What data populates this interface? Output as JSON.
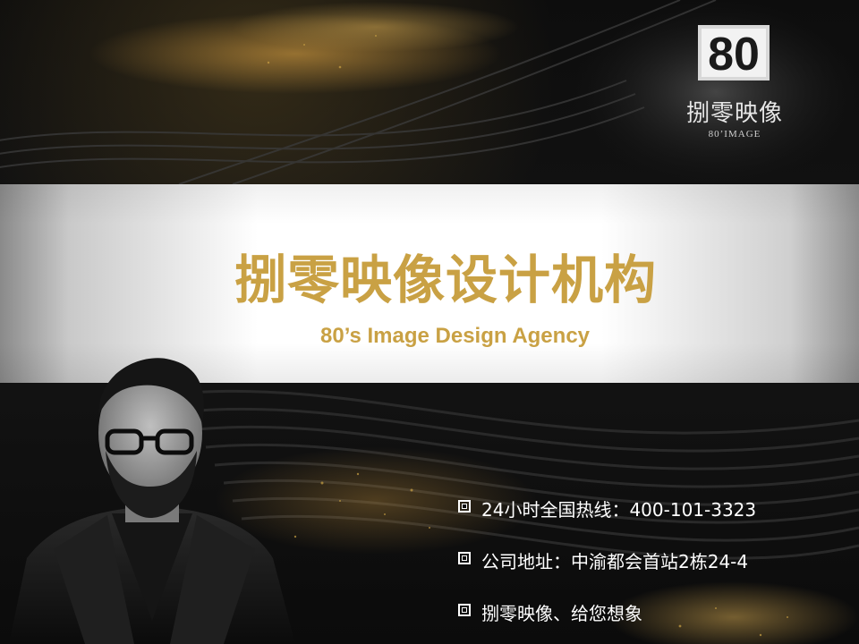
{
  "logo": {
    "mark_text": "80",
    "name_cn": "捌零映像",
    "name_en": "80’IMAGE"
  },
  "hero": {
    "title": "捌零映像设计机构",
    "subtitle": "80’s Image Design Agency"
  },
  "info": {
    "items": [
      {
        "text": "24小时全国热线：400-101-3323"
      },
      {
        "text": "公司地址：中渝都会首站2栋24-4"
      },
      {
        "text": "捌零映像、给您想象"
      }
    ]
  },
  "colors": {
    "accent_gold": "#c9a144",
    "background": "#0d0d0d",
    "band": "#ffffff"
  },
  "icons": {
    "bullet": "square-bullet-icon"
  }
}
